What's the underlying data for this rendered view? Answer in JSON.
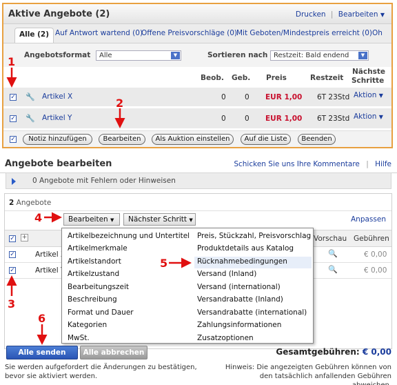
{
  "panel1": {
    "title": "Aktive Angebote (2)",
    "print": "Drucken",
    "separator": "|",
    "edit_menu": "Bearbeiten",
    "tabs": [
      "Alle (2)",
      "Auf Antwort wartend (0)",
      "Offene Preisvorschläge (0)",
      "Mit Geboten/Mindestpreis erreicht (0)",
      "Oh"
    ],
    "format_label": "Angebotsformat",
    "format_value": "Alle",
    "sort_label": "Sortieren nach",
    "sort_value": "Restzeit: Bald endend",
    "columns": {
      "beob": "Beob.",
      "geb": "Geb.",
      "preis": "Preis",
      "restzeit": "Restzeit",
      "next1": "Nächste",
      "next2": "Schritte"
    },
    "rows": [
      {
        "name": "Artikel X",
        "beob": "0",
        "geb": "0",
        "price": "EUR 1,00",
        "time": "6T 23Std",
        "action": "Aktion"
      },
      {
        "name": "Artikel Y",
        "beob": "0",
        "geb": "0",
        "price": "EUR 1,00",
        "time": "6T 23Std",
        "action": "Aktion"
      }
    ],
    "buttons": {
      "note": "Notiz hinzufügen",
      "edit": "Bearbeiten",
      "auction": "Als Auktion einstellen",
      "list": "Auf die Liste",
      "end": "Beenden"
    }
  },
  "panel2": {
    "title": "Angebote bearbeiten",
    "feedback": "Schicken Sie uns Ihre Kommentare",
    "separator": "|",
    "help": "Hilfe",
    "errors": "0 Angebote mit Fehlern oder Hinweisen",
    "count": "2",
    "count_label": "Angebote",
    "edit_dropdown": "Bearbeiten",
    "next_dropdown": "Nächster Schritt",
    "customize": "Anpassen",
    "col_preview": "Vorschau",
    "col_fees": "Gebühren",
    "rows": [
      {
        "name": "Artikel X",
        "fee": "€ 0,00"
      },
      {
        "name": "Artikel Y",
        "fee": "€ 0,00"
      }
    ],
    "menu_left": [
      "Artikelbezeichnung und Untertitel",
      "Artikelmerkmale",
      "Artikelstandort",
      "Artikelzustand",
      "Bearbeitungszeit",
      "Beschreibung",
      "Format und Dauer",
      "Kategorien",
      "MwSt."
    ],
    "menu_right": [
      "Preis, Stückzahl, Preisvorschlag",
      "Produktdetails aus Katalog",
      "Rücknahmebedingungen",
      "Versand (Inland)",
      "Versand (international)",
      "Versandrabatte (Inland)",
      "Versandrabatte (international)",
      "Zahlungsinformationen",
      "Zusatzoptionen"
    ],
    "send_all": "Alle senden",
    "cancel_all": "Alle abbrechen",
    "total_label": "Gesamtgebühren:",
    "total_value": "€ 0,00",
    "note_left_1": "Sie werden aufgefordert die Änderungen zu bestätigen,",
    "note_left_2": "bevor sie aktiviert werden.",
    "note_right_1": "Hinweis: Die angezeigten Gebühren können von",
    "note_right_2": "den tatsächlich anfallenden Gebühren abweichen."
  },
  "annotations": [
    "1",
    "2",
    "3",
    "4",
    "5",
    "6"
  ],
  "colors": {
    "accent_orange": "#e8a040",
    "link_blue": "#1a3c9c",
    "price_red": "#c8102e",
    "marker_red": "#e01010"
  }
}
